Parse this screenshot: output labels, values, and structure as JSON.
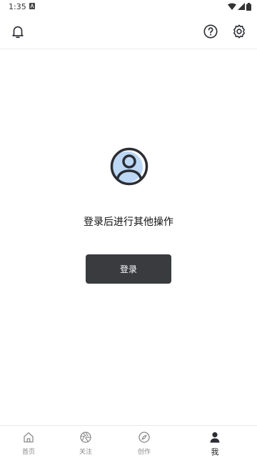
{
  "status_bar": {
    "time": "1:35",
    "icons": [
      "notification-icon",
      "wifi-icon",
      "cellular-icon",
      "battery-icon"
    ]
  },
  "top_bar": {
    "icons": [
      "bell-icon",
      "help-icon",
      "settings-icon"
    ]
  },
  "empty_state": {
    "icon": "user-avatar-icon",
    "message": "登录后进行其他操作",
    "login_button_label": "登录"
  },
  "bottom_nav": {
    "items": [
      {
        "label": "首页",
        "icon": "home-icon",
        "active": false
      },
      {
        "label": "关注",
        "icon": "aperture-icon",
        "active": false
      },
      {
        "label": "创作",
        "icon": "compass-icon",
        "active": false
      },
      {
        "label": "我",
        "icon": "person-icon",
        "active": true
      }
    ]
  },
  "colors": {
    "button_bg": "#3a3b3f",
    "avatar_accent": "#bcd8f5",
    "icon_dark": "#2b2d33",
    "inactive_text": "#8a8a8a"
  }
}
